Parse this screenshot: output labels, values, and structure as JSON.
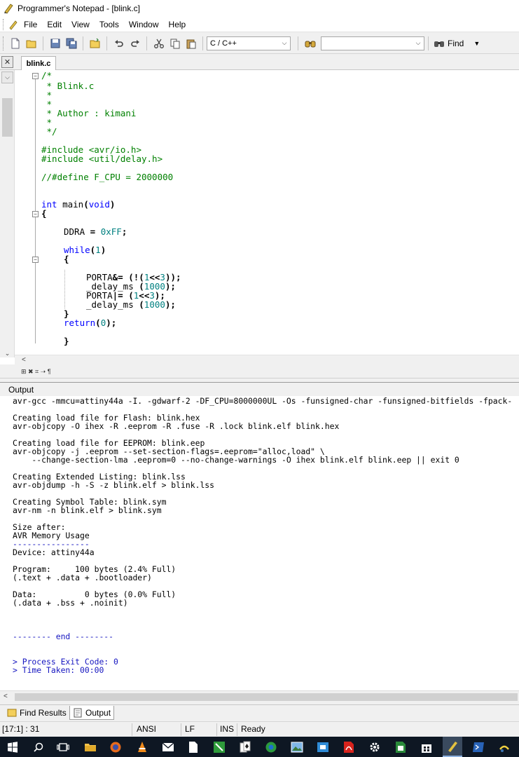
{
  "window": {
    "title": "Programmer's Notepad - [blink.c]"
  },
  "menu": [
    "File",
    "Edit",
    "View",
    "Tools",
    "Window",
    "Help"
  ],
  "toolbar": {
    "scheme_select": "C / C++",
    "search_value": "",
    "find_label": "Find"
  },
  "tabs": {
    "doc": "blink.c"
  },
  "code_lines": [
    "/*",
    " * Blink.c",
    " *",
    " *",
    " * Author : kimani",
    " *",
    " */",
    "#include <avr/io.h>",
    "#include <util/delay.h>",
    "//#define F_CPU = 2000000",
    "int main(void)",
    "{",
    "DDRA = 0xFF;",
    "while(1)",
    "{",
    "PORTA&= (!(1<<3));",
    "_delay_ms (1000);",
    "PORTA|= (1<<3);",
    "_delay_ms (1000);",
    "}",
    "return(0);",
    "}"
  ],
  "output_panel": {
    "title": "Output",
    "lines": [
      "avr-gcc -mmcu=attiny44a -I. -gdwarf-2 -DF_CPU=8000000UL -Os -funsigned-char -funsigned-bitfields -fpack-",
      "",
      "Creating load file for Flash: blink.hex",
      "avr-objcopy -O ihex -R .eeprom -R .fuse -R .lock blink.elf blink.hex",
      "",
      "Creating load file for EEPROM: blink.eep",
      "avr-objcopy -j .eeprom --set-section-flags=.eeprom=\"alloc,load\" \\",
      "    --change-section-lma .eeprom=0 --no-change-warnings -O ihex blink.elf blink.eep || exit 0",
      "",
      "Creating Extended Listing: blink.lss",
      "avr-objdump -h -S -z blink.elf > blink.lss",
      "",
      "Creating Symbol Table: blink.sym",
      "avr-nm -n blink.elf > blink.sym",
      "",
      "Size after:",
      "AVR Memory Usage",
      "----------------",
      "Device: attiny44a",
      "",
      "Program:     100 bytes (2.4% Full)",
      "(.text + .data + .bootloader)",
      "",
      "Data:          0 bytes (0.0% Full)",
      "(.data + .bss + .noinit)",
      "",
      "",
      "",
      "-------- end --------",
      "",
      "",
      "> Process Exit Code: 0",
      "> Time Taken: 00:00"
    ]
  },
  "bottom_tabs": [
    "Find Results",
    "Output"
  ],
  "status": {
    "position": "[17:1] : 31",
    "encoding": "ANSI",
    "line_ending": "LF",
    "mode": "INS",
    "state": "Ready"
  },
  "colors": {
    "comment": "#008000",
    "keyword": "#0000ff",
    "number": "#008080",
    "output_info": "#1515c0",
    "taskbar": "#0e1723"
  },
  "taskbar_icons": [
    "windows-start-icon",
    "search-icon",
    "task-view-icon",
    "file-explorer-icon",
    "firefox-icon",
    "vlc-icon",
    "mail-icon",
    "notepad-icon",
    "app-green-icon",
    "solitaire-icon",
    "edge-icon",
    "photos-icon",
    "app-blue-icon",
    "acrobat-icon",
    "settings-icon",
    "excel-icon",
    "store-icon",
    "programmers-notepad-icon",
    "powershell-icon",
    "python-icon"
  ]
}
